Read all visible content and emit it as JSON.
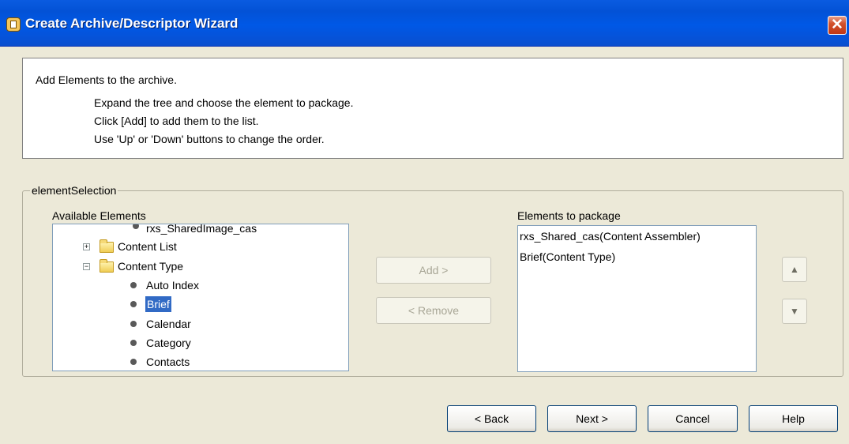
{
  "window": {
    "title": "Create Archive/Descriptor Wizard",
    "close_glyph": "✕"
  },
  "info": {
    "heading": "Add Elements to the archive.",
    "lines": [
      "Expand the tree and choose the element to package.",
      "Click [Add] to add them to the list.",
      "Use 'Up' or 'Down' buttons to change the order."
    ]
  },
  "group": {
    "label": "elementSelection",
    "available_label": "Available Elements",
    "package_label": "Elements to package"
  },
  "tree": {
    "rows": [
      {
        "text": "rxs_SharedImage_cas",
        "type": "leaf"
      },
      {
        "text": "Content List",
        "type": "folder",
        "expander": "+"
      },
      {
        "text": "Content Type",
        "type": "folder-open",
        "expander": "−"
      },
      {
        "text": "Auto Index",
        "type": "leaf"
      },
      {
        "text": "Brief",
        "type": "leaf",
        "selected": true
      },
      {
        "text": "Calendar",
        "type": "leaf"
      },
      {
        "text": "Category",
        "type": "leaf"
      },
      {
        "text": "Contacts",
        "type": "leaf"
      }
    ]
  },
  "scrollbar": {
    "up_glyph": "▲",
    "down_glyph": "▼"
  },
  "middle_buttons": {
    "add": "Add >",
    "remove": "< Remove"
  },
  "package_list": {
    "items": [
      "rxs_Shared_cas(Content Assembler)",
      "Brief(Content Type)"
    ]
  },
  "order_buttons": {
    "up_glyph": "▲",
    "down_glyph": "▼"
  },
  "footer": {
    "back": "< Back",
    "next": "Next >",
    "cancel": "Cancel",
    "help": "Help"
  }
}
